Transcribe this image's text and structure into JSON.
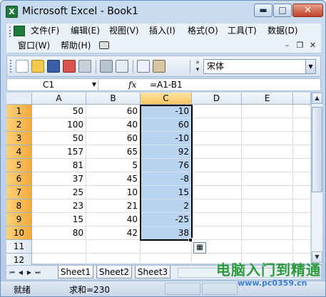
{
  "window": {
    "title": "Microsoft Excel - Book1",
    "app_icon_letter": "X",
    "buttons": {
      "minimize": "▬",
      "maximize": "□",
      "close": "✕"
    }
  },
  "menubar": {
    "items": [
      "文件(F)",
      "编辑(E)",
      "视图(V)",
      "插入(I)",
      "格式(O)",
      "工具(T)",
      "数据(D)",
      "窗口(W)",
      "帮助(H)"
    ],
    "mdi": {
      "minimize": "–",
      "restore": "❐",
      "close": "✕"
    }
  },
  "toolbar": {
    "font_name": "宋体"
  },
  "formula": {
    "name_box": "C1",
    "fx": "fx",
    "text": "=A1-B1"
  },
  "grid": {
    "columns": [
      "A",
      "B",
      "C",
      "D",
      "E"
    ],
    "selected_column": "C",
    "rows": [
      {
        "n": "1",
        "a": "50",
        "b": "60",
        "c": "-10"
      },
      {
        "n": "2",
        "a": "100",
        "b": "40",
        "c": "60"
      },
      {
        "n": "3",
        "a": "50",
        "b": "60",
        "c": "-10"
      },
      {
        "n": "4",
        "a": "157",
        "b": "65",
        "c": "92"
      },
      {
        "n": "5",
        "a": "81",
        "b": "5",
        "c": "76"
      },
      {
        "n": "6",
        "a": "37",
        "b": "45",
        "c": "-8"
      },
      {
        "n": "7",
        "a": "25",
        "b": "10",
        "c": "15"
      },
      {
        "n": "8",
        "a": "23",
        "b": "21",
        "c": "2"
      },
      {
        "n": "9",
        "a": "15",
        "b": "40",
        "c": "-25"
      },
      {
        "n": "10",
        "a": "80",
        "b": "42",
        "c": "38"
      },
      {
        "n": "11",
        "a": "",
        "b": "",
        "c": ""
      },
      {
        "n": "12",
        "a": "",
        "b": "",
        "c": ""
      }
    ]
  },
  "sheets": {
    "tabs": [
      "Sheet1",
      "Sheet2",
      "Sheet3"
    ],
    "active": "Sheet1",
    "nav": [
      "⏮",
      "◀",
      "▶",
      "⏭"
    ]
  },
  "status": {
    "ready": "就绪",
    "sum": "求和=230"
  },
  "watermark": {
    "text": "电脑入门到精通",
    "url": "www.pc0359.cn"
  }
}
